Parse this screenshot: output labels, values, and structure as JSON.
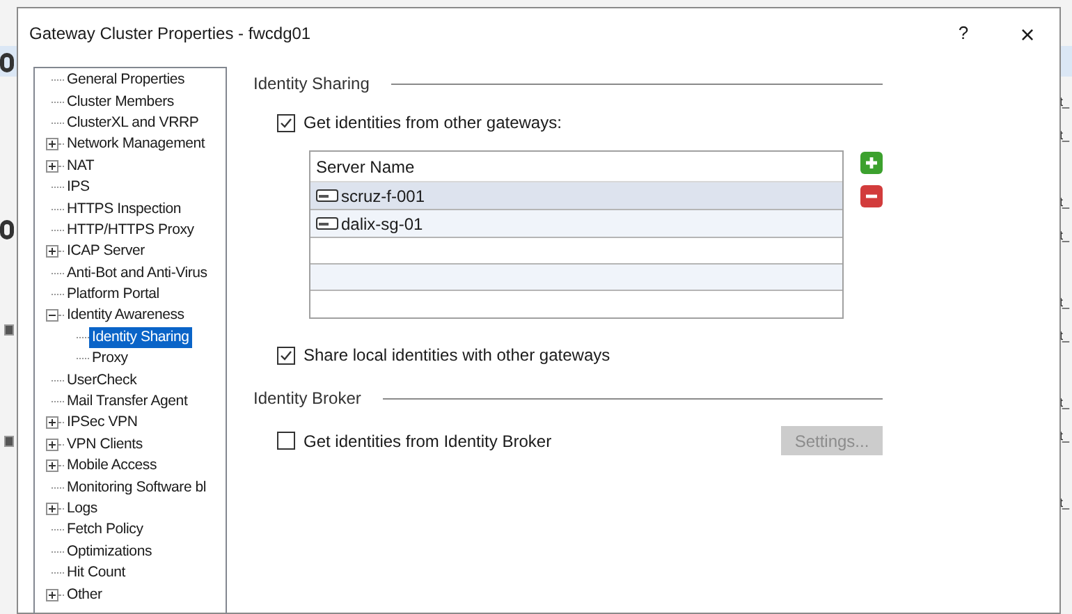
{
  "background": {
    "right_column": [
      "t_",
      "t_",
      "t_",
      "t_",
      "t_",
      "t_",
      "t_",
      "t_",
      "t_"
    ]
  },
  "window": {
    "title": "Gateway Cluster Properties - fwcdg01",
    "help": "?",
    "close": "×"
  },
  "tree": [
    {
      "label": "General Properties",
      "kind": "leaf",
      "selected": false
    },
    {
      "label": "Cluster Members",
      "kind": "leaf",
      "selected": false
    },
    {
      "label": "ClusterXL and VRRP",
      "kind": "leaf",
      "selected": false
    },
    {
      "label": "Network Management",
      "kind": "folder",
      "expanded": false,
      "selected": false
    },
    {
      "label": "NAT",
      "kind": "folder",
      "expanded": false,
      "selected": false
    },
    {
      "label": "IPS",
      "kind": "leaf",
      "selected": false
    },
    {
      "label": "HTTPS Inspection",
      "kind": "leaf",
      "selected": false
    },
    {
      "label": "HTTP/HTTPS Proxy",
      "kind": "leaf",
      "selected": false
    },
    {
      "label": "ICAP Server",
      "kind": "folder",
      "expanded": false,
      "selected": false
    },
    {
      "label": "Anti-Bot and Anti-Virus",
      "kind": "leaf",
      "selected": false
    },
    {
      "label": "Platform Portal",
      "kind": "leaf",
      "selected": false
    },
    {
      "label": "Identity Awareness",
      "kind": "folder",
      "expanded": true,
      "selected": false,
      "children": [
        {
          "label": "Identity Sharing",
          "selected": true
        },
        {
          "label": "Proxy",
          "selected": false
        }
      ]
    },
    {
      "label": "UserCheck",
      "kind": "leaf",
      "selected": false
    },
    {
      "label": "Mail Transfer Agent",
      "kind": "leaf",
      "selected": false
    },
    {
      "label": "IPSec VPN",
      "kind": "folder",
      "expanded": false,
      "selected": false
    },
    {
      "label": "VPN Clients",
      "kind": "folder",
      "expanded": false,
      "selected": false
    },
    {
      "label": "Mobile Access",
      "kind": "folder",
      "expanded": false,
      "selected": false
    },
    {
      "label": "Monitoring Software bl",
      "kind": "leaf",
      "selected": false
    },
    {
      "label": "Logs",
      "kind": "folder",
      "expanded": false,
      "selected": false
    },
    {
      "label": "Fetch Policy",
      "kind": "leaf",
      "selected": false
    },
    {
      "label": "Optimizations",
      "kind": "leaf",
      "selected": false
    },
    {
      "label": "Hit Count",
      "kind": "leaf",
      "selected": false
    },
    {
      "label": "Other",
      "kind": "folder",
      "expanded": false,
      "selected": false
    }
  ],
  "identity_sharing": {
    "title": "Identity Sharing",
    "get_from_gateways": {
      "label": "Get identities from other gateways:",
      "checked": true
    },
    "table": {
      "columns": [
        "Server Name"
      ],
      "rows": [
        {
          "name": "scruz-f-001",
          "selected": true
        },
        {
          "name": "dalix-sg-01",
          "selected": false
        }
      ]
    },
    "share_local": {
      "label": "Share local identities with other gateways",
      "checked": true
    }
  },
  "identity_broker": {
    "title": "Identity Broker",
    "get_from_broker": {
      "label": "Get identities from Identity Broker",
      "checked": false
    },
    "settings_button": {
      "label": "Settings...",
      "disabled": true
    }
  }
}
